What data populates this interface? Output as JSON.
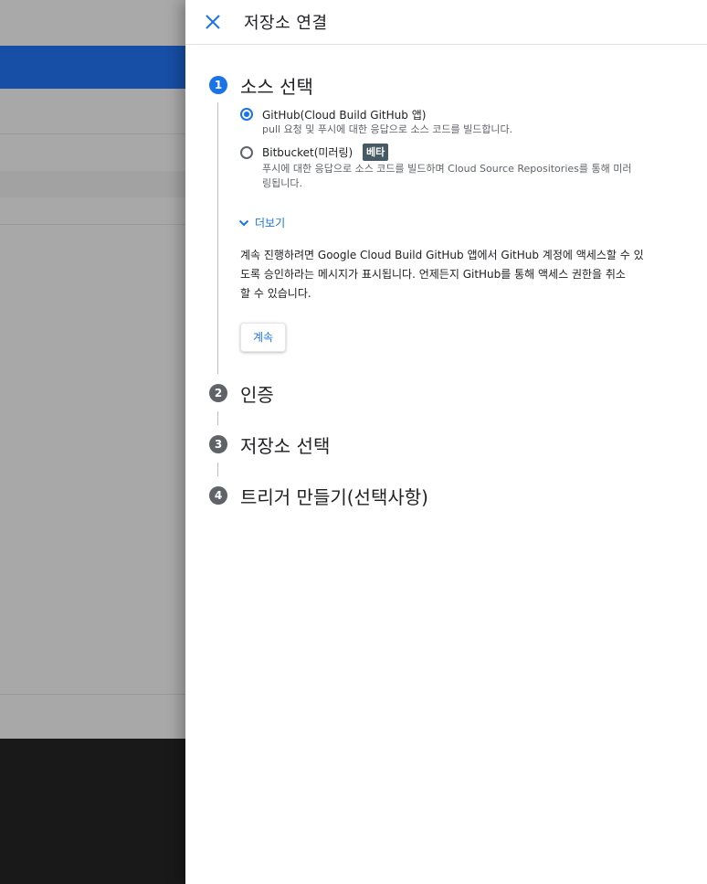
{
  "panel": {
    "title": "저장소 연결",
    "close_icon": "close-icon"
  },
  "steps": [
    {
      "number": "1",
      "title": "소스 선택",
      "state": "active"
    },
    {
      "number": "2",
      "title": "인증",
      "state": "inactive"
    },
    {
      "number": "3",
      "title": "저장소 선택",
      "state": "inactive"
    },
    {
      "number": "4",
      "title": "트리거 만들기(선택사항)",
      "state": "inactive"
    }
  ],
  "source_options": [
    {
      "label": "GitHub(Cloud Build GitHub 앱)",
      "description": "pull 요청 및 푸시에 대한 응답으로 소스 코드를 빌드합니다.",
      "selected": true
    },
    {
      "label": "Bitbucket(미러링)",
      "badge": "베타",
      "description_line1": "푸시에 대한 응답으로 소스 코드를 빌드하며 Cloud Source Repositories를 통해 미러",
      "description_line2": "링됩니다.",
      "selected": false
    }
  ],
  "show_more": "더보기",
  "info_text": {
    "line1": "계속 진행하려면 Google Cloud Build GitHub 앱에서 GitHub 계정에 액세스할 수 있",
    "line2": "도록 승인하라는 메시지가 표시됩니다. 언제든지 GitHub를 통해 액세스 권한을 취소",
    "line3": "할 수 있습니다."
  },
  "continue_label": "계속",
  "colors": {
    "accent": "#1a73e8",
    "header_bar": "#174ea6",
    "badge_bg": "#455a64"
  }
}
